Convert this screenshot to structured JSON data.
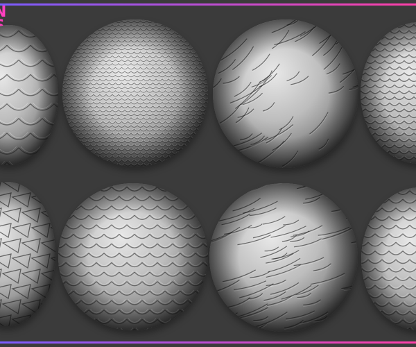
{
  "logo": {
    "line1": "N",
    "line2": "S",
    "color": "#ff3fbf"
  },
  "bars": {
    "top_gradient": [
      "#7b5cff",
      "#ff3fa8"
    ],
    "bottom_gradient": [
      "#7b5cff",
      "#ff3fa8"
    ]
  },
  "background_color": "#3b3b3b",
  "spheres": [
    {
      "name": "sphere-large-dragon-scales",
      "pattern": "large-scales"
    },
    {
      "name": "sphere-fine-dense-scales",
      "pattern": "fine-scales"
    },
    {
      "name": "sphere-feathered-scales",
      "pattern": "feathers"
    },
    {
      "name": "sphere-small-round-scales",
      "pattern": "round-scales"
    },
    {
      "name": "sphere-overlapping-plates",
      "pattern": "plates"
    },
    {
      "name": "sphere-smooth-lozenge-scales",
      "pattern": "lozenge-scales"
    },
    {
      "name": "sphere-streaked-feathers",
      "pattern": "streaks"
    },
    {
      "name": "sphere-raised-leaf-scales",
      "pattern": "leaf-scales"
    }
  ]
}
